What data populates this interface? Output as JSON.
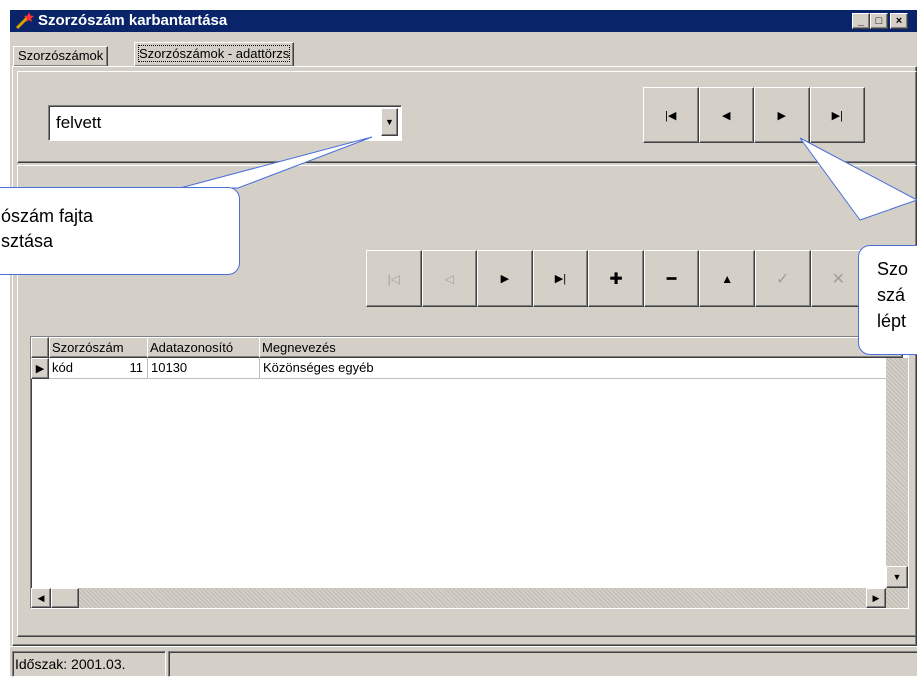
{
  "window": {
    "title": "Szorzószám karbantartása",
    "icon": "magic-wand-icon",
    "controls": [
      "_",
      "□",
      "×"
    ]
  },
  "tabs": [
    {
      "label": "Szorzószámok",
      "active": false
    },
    {
      "label": "Szorzószámok - adattörzs",
      "active": true
    }
  ],
  "filter": {
    "value": "felvett"
  },
  "navigator_top": {
    "buttons": [
      {
        "name": "first-record-button",
        "glyph": "|◀"
      },
      {
        "name": "prior-record-button",
        "glyph": "◀"
      },
      {
        "name": "next-record-button",
        "glyph": "▶"
      },
      {
        "name": "last-record-button",
        "glyph": "▶|"
      }
    ]
  },
  "navigator_data": {
    "buttons": [
      {
        "name": "first-record-button",
        "glyph": "|◁",
        "enabled": false
      },
      {
        "name": "prior-record-button",
        "glyph": "◁",
        "enabled": false
      },
      {
        "name": "next-record-button",
        "glyph": "▶",
        "enabled": true
      },
      {
        "name": "last-record-button",
        "glyph": "▶|",
        "enabled": true
      },
      {
        "name": "insert-record-button",
        "glyph": "✚",
        "enabled": true
      },
      {
        "name": "delete-record-button",
        "glyph": "━",
        "enabled": true
      },
      {
        "name": "edit-record-button",
        "glyph": "▲",
        "enabled": true
      },
      {
        "name": "post-record-button",
        "glyph": "✓",
        "enabled": false
      },
      {
        "name": "cancel-record-button",
        "glyph": "✕",
        "enabled": false
      }
    ]
  },
  "grid": {
    "columns": [
      "Szorzószám kód",
      "Adatazonosító",
      "Megnevezés"
    ],
    "rows": [
      {
        "code": "11",
        "id": "10130",
        "name": "Közönséges egyéb"
      }
    ]
  },
  "callouts": {
    "left": {
      "line1": "ószám fajta",
      "line2": "sztása"
    },
    "right": {
      "line1": "Szo",
      "line2": "szá",
      "line3": "lépt"
    }
  },
  "status": {
    "period": "Időszak: 2001.03."
  },
  "colors": {
    "titlebar": "#0a246a",
    "face": "#d4d0c8",
    "callout_border": "#4a6fd9"
  }
}
